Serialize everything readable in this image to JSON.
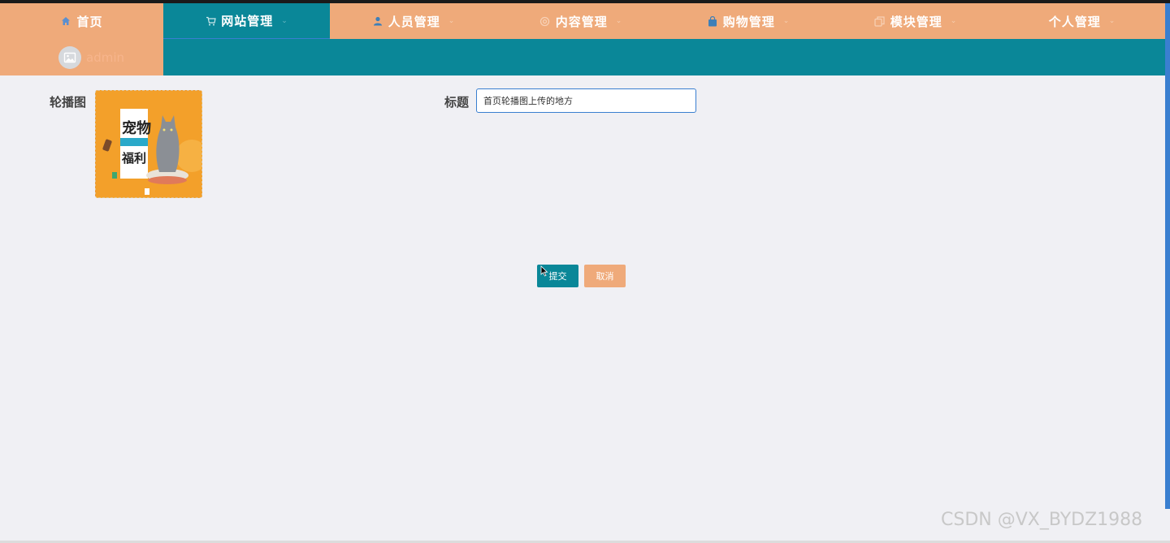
{
  "nav": {
    "items": [
      {
        "label": "首页",
        "icon": "home-icon",
        "active": false,
        "has_dropdown": false
      },
      {
        "label": "网站管理",
        "icon": "cart-icon",
        "active": true,
        "has_dropdown": true
      },
      {
        "label": "人员管理",
        "icon": "user-icon",
        "active": false,
        "has_dropdown": true
      },
      {
        "label": "内容管理",
        "icon": "settings-icon",
        "active": false,
        "has_dropdown": true
      },
      {
        "label": "购物管理",
        "icon": "shopping-bag-icon",
        "active": false,
        "has_dropdown": true
      },
      {
        "label": "模块管理",
        "icon": "copy-icon",
        "active": false,
        "has_dropdown": true
      },
      {
        "label": "个人管理",
        "icon": "",
        "active": false,
        "has_dropdown": true
      }
    ],
    "dropdown_glyph": "⌄"
  },
  "user": {
    "name": "admin",
    "avatar_icon": "image-icon"
  },
  "form": {
    "carousel_label": "轮播图",
    "banner_image_icon": "pet-banner-image",
    "title_label": "标题",
    "title_value": "首页轮播图上传的地方"
  },
  "buttons": {
    "submit": "提交",
    "cancel": "取消"
  },
  "watermark": "CSDN @VX_BYDZ1988",
  "colors": {
    "teal": "#0a8798",
    "orange": "#efaa7a",
    "background": "#f0f0f4",
    "focus_border": "#3a7fd0"
  }
}
